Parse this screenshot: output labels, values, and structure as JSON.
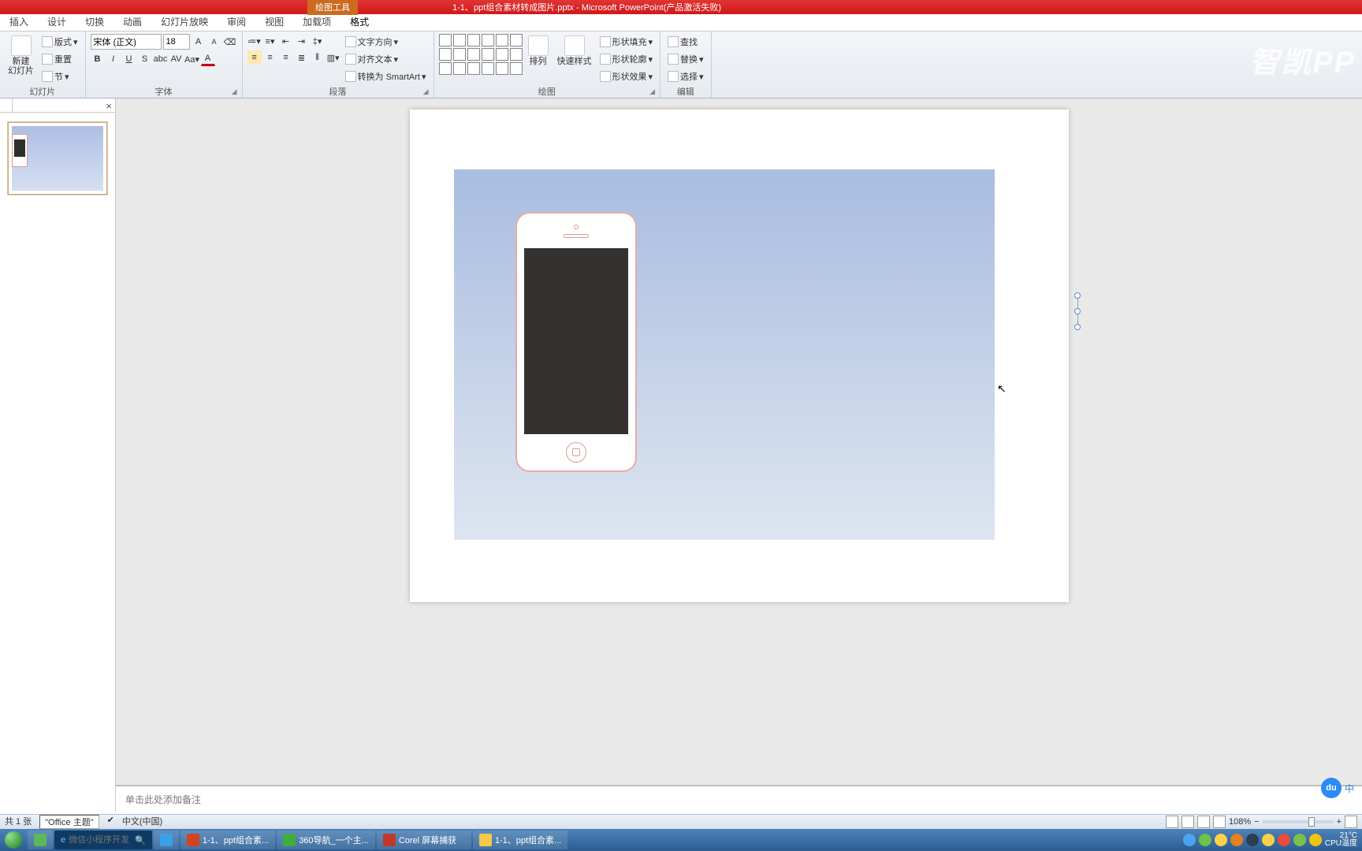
{
  "title": {
    "tool_tab": "绘图工具",
    "file": "1-1、ppt组合素材转成图片.pptx - Microsoft PowerPoint(产品激活失败)"
  },
  "tabs": {
    "insert": "插入",
    "design": "设计",
    "transition": "切换",
    "animation": "动画",
    "slideshow": "幻灯片放映",
    "review": "审阅",
    "view": "视图",
    "addins": "加载项",
    "format": "格式"
  },
  "ribbon": {
    "slides": {
      "new_slide": "新建\n幻灯片",
      "layout": "版式",
      "reset": "重置",
      "section": "节",
      "title": "幻灯片"
    },
    "font": {
      "name": "宋体 (正文)",
      "size": "18",
      "title": "字体"
    },
    "paragraph": {
      "text_dir": "文字方向",
      "align_text": "对齐文本",
      "smartart": "转换为 SmartArt",
      "title": "段落"
    },
    "draw": {
      "arrange": "排列",
      "quick": "快速样式",
      "fill": "形状填充",
      "outline": "形状轮廓",
      "effect": "形状效果",
      "title": "绘图"
    },
    "edit": {
      "find": "查找",
      "replace": "替换",
      "select": "选择",
      "title": "编辑"
    }
  },
  "notes_placeholder": "单击此处添加备注",
  "status": {
    "slide_count": "共 1 张",
    "theme": "\"Office 主题\"",
    "lang": "中文(中国)",
    "zoom": "108%"
  },
  "taskbar": {
    "search_placeholder": "微信小程序开发",
    "items": [
      {
        "label": "1-1、ppt组合素..."
      },
      {
        "label": "360导航_一个主..."
      },
      {
        "label": "Corel 屏幕捕获"
      },
      {
        "label": "1-1、ppt组合素..."
      }
    ],
    "temp_line1": "21°C",
    "temp_line2": "CPU温度"
  },
  "watermark": "智凯PP",
  "float": {
    "zh": "中"
  }
}
